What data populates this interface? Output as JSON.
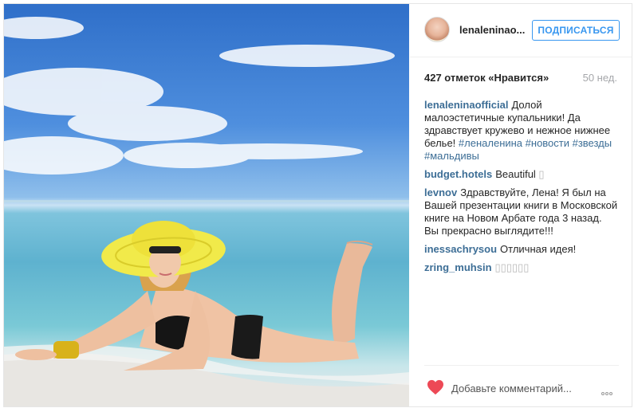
{
  "post": {
    "username": "lenaleninao...",
    "follow_label": "ПОДПИСАТЬСЯ",
    "likes": "427 отметок «Нравится»",
    "age": "50 нед.",
    "caption": {
      "user": "lenaleninaofficial",
      "text": "Долой малоэстетичные купальники! Да здравствует кружево и нежное нижнее белье! ",
      "tags": "#леналенина #новости #звезды #мальдивы"
    },
    "comments": [
      {
        "user": "budget.hotels",
        "text": "Beautiful ",
        "glyph": "▯"
      },
      {
        "user": "levnov",
        "text": "Здравствуйте, Лена! Я был на Вашей презентации книги в Московской книге на Новом Арбате года 3 назад. Вы прекрасно выглядите!!!",
        "glyph": ""
      },
      {
        "user": "inessachrysou",
        "text": "Отличная идея!",
        "glyph": ""
      },
      {
        "user": "zring_muhsin",
        "text": "",
        "glyph": "▯▯▯▯▯▯"
      }
    ],
    "comment_placeholder": "Добавьте комментарий...",
    "icons": {
      "like": "heart-icon",
      "more": "more-options-icon"
    },
    "colors": {
      "heart": "#ed4956",
      "follow": "#3897f0",
      "username": "#3d6e96"
    }
  }
}
